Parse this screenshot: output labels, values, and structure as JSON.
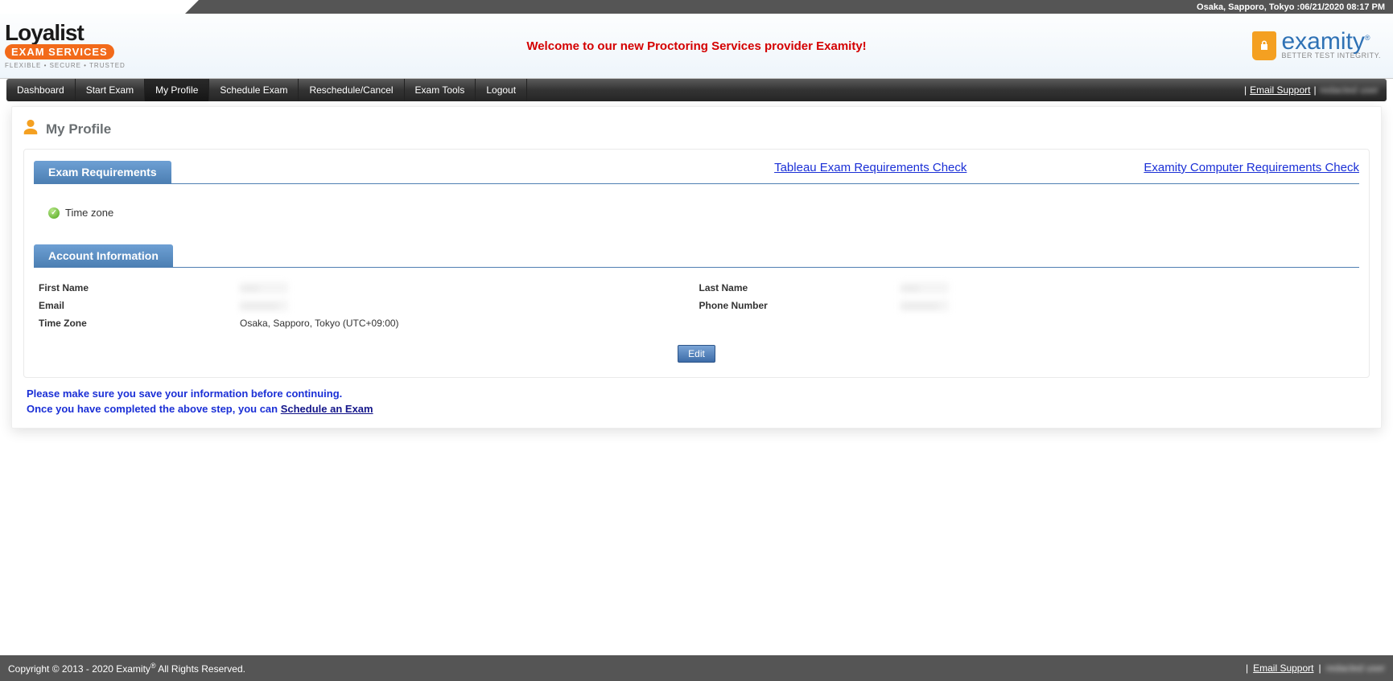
{
  "topbar": {
    "datetime": "Osaka, Sapporo, Tokyo :06/21/2020 08:17 PM"
  },
  "logo": {
    "brand_top": "Loyalist",
    "brand_badge": "EXAM SERVICES",
    "brand_tagline": "FLEXIBLE • SECURE • TRUSTED"
  },
  "banner": {
    "welcome": "Welcome to our new Proctoring Services provider Examity!",
    "examity_name": "examity",
    "examity_tagline": "BETTER TEST INTEGRITY."
  },
  "nav": {
    "items": [
      {
        "label": "Dashboard",
        "active": false
      },
      {
        "label": "Start Exam",
        "active": false
      },
      {
        "label": "My Profile",
        "active": true
      },
      {
        "label": "Schedule Exam",
        "active": false
      },
      {
        "label": "Reschedule/Cancel",
        "active": false
      },
      {
        "label": "Exam Tools",
        "active": false
      },
      {
        "label": "Logout",
        "active": false
      }
    ],
    "email_support": "Email Support",
    "user_display": "redacted user"
  },
  "page": {
    "title": "My Profile"
  },
  "exam_req": {
    "header": "Exam Requirements",
    "link_tableau": "Tableau Exam Requirements Check",
    "link_examity": "Examity Computer Requirements Check",
    "item_timezone": "Time zone"
  },
  "account": {
    "header": "Account Information",
    "labels": {
      "first_name": "First Name",
      "last_name": "Last Name",
      "email": "Email",
      "phone": "Phone Number",
      "timezone": "Time Zone"
    },
    "values": {
      "first_name": "——",
      "last_name": "——",
      "email": "————",
      "phone": "————",
      "timezone": "Osaka, Sapporo, Tokyo (UTC+09:00)"
    },
    "edit_label": "Edit"
  },
  "notices": {
    "line1": "Please make sure you save your information before continuing.",
    "line2_prefix": "Once you have completed the above step, you can ",
    "line2_link": "Schedule an Exam"
  },
  "footer": {
    "copyright_prefix": "Copyright © 2013 - 2020 Examity",
    "reg": "®",
    "copyright_suffix": "  All Rights Reserved.",
    "email_support": "Email Support",
    "user_display": "redacted user"
  }
}
